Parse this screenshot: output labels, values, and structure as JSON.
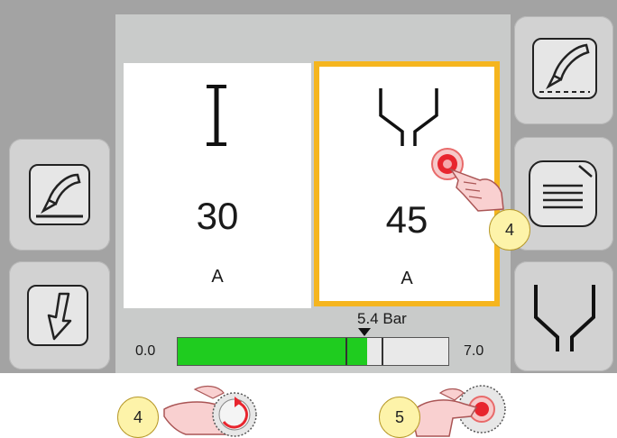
{
  "pressure": {
    "min_label": "0.0",
    "max_label": "7.0",
    "value_label": "5.4 Bar",
    "fill_fraction": 0.7
  },
  "panels": {
    "current": {
      "value": "30",
      "unit": "A"
    },
    "angle": {
      "value": "45",
      "unit": "A"
    }
  },
  "callouts": {
    "panel_touch": "4",
    "knob_turn": "4",
    "knob_press": "5"
  },
  "colors": {
    "selection": "#f5b51e",
    "bar_fill": "#1fcc1f",
    "badge": "#fdf3a9"
  },
  "icons": {
    "left_top": "welding-torch-icon",
    "left_bottom": "down-arrow-icon",
    "right_top": "torch-gas-icon",
    "right_middle": "document-icon",
    "right_bottom": "nozzle-icon"
  }
}
